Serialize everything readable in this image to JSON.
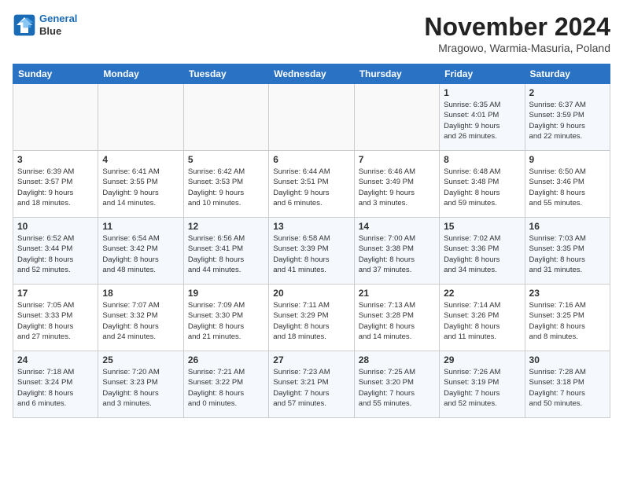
{
  "header": {
    "logo_line1": "General",
    "logo_line2": "Blue",
    "title": "November 2024",
    "location": "Mragowo, Warmia-Masuria, Poland"
  },
  "weekdays": [
    "Sunday",
    "Monday",
    "Tuesday",
    "Wednesday",
    "Thursday",
    "Friday",
    "Saturday"
  ],
  "weeks": [
    [
      {
        "day": "",
        "info": ""
      },
      {
        "day": "",
        "info": ""
      },
      {
        "day": "",
        "info": ""
      },
      {
        "day": "",
        "info": ""
      },
      {
        "day": "",
        "info": ""
      },
      {
        "day": "1",
        "info": "Sunrise: 6:35 AM\nSunset: 4:01 PM\nDaylight: 9 hours\nand 26 minutes."
      },
      {
        "day": "2",
        "info": "Sunrise: 6:37 AM\nSunset: 3:59 PM\nDaylight: 9 hours\nand 22 minutes."
      }
    ],
    [
      {
        "day": "3",
        "info": "Sunrise: 6:39 AM\nSunset: 3:57 PM\nDaylight: 9 hours\nand 18 minutes."
      },
      {
        "day": "4",
        "info": "Sunrise: 6:41 AM\nSunset: 3:55 PM\nDaylight: 9 hours\nand 14 minutes."
      },
      {
        "day": "5",
        "info": "Sunrise: 6:42 AM\nSunset: 3:53 PM\nDaylight: 9 hours\nand 10 minutes."
      },
      {
        "day": "6",
        "info": "Sunrise: 6:44 AM\nSunset: 3:51 PM\nDaylight: 9 hours\nand 6 minutes."
      },
      {
        "day": "7",
        "info": "Sunrise: 6:46 AM\nSunset: 3:49 PM\nDaylight: 9 hours\nand 3 minutes."
      },
      {
        "day": "8",
        "info": "Sunrise: 6:48 AM\nSunset: 3:48 PM\nDaylight: 8 hours\nand 59 minutes."
      },
      {
        "day": "9",
        "info": "Sunrise: 6:50 AM\nSunset: 3:46 PM\nDaylight: 8 hours\nand 55 minutes."
      }
    ],
    [
      {
        "day": "10",
        "info": "Sunrise: 6:52 AM\nSunset: 3:44 PM\nDaylight: 8 hours\nand 52 minutes."
      },
      {
        "day": "11",
        "info": "Sunrise: 6:54 AM\nSunset: 3:42 PM\nDaylight: 8 hours\nand 48 minutes."
      },
      {
        "day": "12",
        "info": "Sunrise: 6:56 AM\nSunset: 3:41 PM\nDaylight: 8 hours\nand 44 minutes."
      },
      {
        "day": "13",
        "info": "Sunrise: 6:58 AM\nSunset: 3:39 PM\nDaylight: 8 hours\nand 41 minutes."
      },
      {
        "day": "14",
        "info": "Sunrise: 7:00 AM\nSunset: 3:38 PM\nDaylight: 8 hours\nand 37 minutes."
      },
      {
        "day": "15",
        "info": "Sunrise: 7:02 AM\nSunset: 3:36 PM\nDaylight: 8 hours\nand 34 minutes."
      },
      {
        "day": "16",
        "info": "Sunrise: 7:03 AM\nSunset: 3:35 PM\nDaylight: 8 hours\nand 31 minutes."
      }
    ],
    [
      {
        "day": "17",
        "info": "Sunrise: 7:05 AM\nSunset: 3:33 PM\nDaylight: 8 hours\nand 27 minutes."
      },
      {
        "day": "18",
        "info": "Sunrise: 7:07 AM\nSunset: 3:32 PM\nDaylight: 8 hours\nand 24 minutes."
      },
      {
        "day": "19",
        "info": "Sunrise: 7:09 AM\nSunset: 3:30 PM\nDaylight: 8 hours\nand 21 minutes."
      },
      {
        "day": "20",
        "info": "Sunrise: 7:11 AM\nSunset: 3:29 PM\nDaylight: 8 hours\nand 18 minutes."
      },
      {
        "day": "21",
        "info": "Sunrise: 7:13 AM\nSunset: 3:28 PM\nDaylight: 8 hours\nand 14 minutes."
      },
      {
        "day": "22",
        "info": "Sunrise: 7:14 AM\nSunset: 3:26 PM\nDaylight: 8 hours\nand 11 minutes."
      },
      {
        "day": "23",
        "info": "Sunrise: 7:16 AM\nSunset: 3:25 PM\nDaylight: 8 hours\nand 8 minutes."
      }
    ],
    [
      {
        "day": "24",
        "info": "Sunrise: 7:18 AM\nSunset: 3:24 PM\nDaylight: 8 hours\nand 6 minutes."
      },
      {
        "day": "25",
        "info": "Sunrise: 7:20 AM\nSunset: 3:23 PM\nDaylight: 8 hours\nand 3 minutes."
      },
      {
        "day": "26",
        "info": "Sunrise: 7:21 AM\nSunset: 3:22 PM\nDaylight: 8 hours\nand 0 minutes."
      },
      {
        "day": "27",
        "info": "Sunrise: 7:23 AM\nSunset: 3:21 PM\nDaylight: 7 hours\nand 57 minutes."
      },
      {
        "day": "28",
        "info": "Sunrise: 7:25 AM\nSunset: 3:20 PM\nDaylight: 7 hours\nand 55 minutes."
      },
      {
        "day": "29",
        "info": "Sunrise: 7:26 AM\nSunset: 3:19 PM\nDaylight: 7 hours\nand 52 minutes."
      },
      {
        "day": "30",
        "info": "Sunrise: 7:28 AM\nSunset: 3:18 PM\nDaylight: 7 hours\nand 50 minutes."
      }
    ]
  ]
}
